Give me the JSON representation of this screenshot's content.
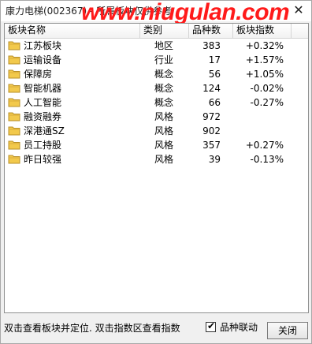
{
  "window": {
    "title": "康力电梯(002367) - 所属板块仅供参考",
    "watermark": "www.niugulan.com"
  },
  "table": {
    "headers": [
      "板块名称",
      "类别",
      "品种数",
      "板块指数"
    ],
    "rows": [
      {
        "name": "江苏板块",
        "category": "地区",
        "count": "383",
        "index": "+0.32%"
      },
      {
        "name": "运输设备",
        "category": "行业",
        "count": "17",
        "index": "+1.57%"
      },
      {
        "name": "保障房",
        "category": "概念",
        "count": "56",
        "index": "+1.05%"
      },
      {
        "name": "智能机器",
        "category": "概念",
        "count": "124",
        "index": "-0.02%"
      },
      {
        "name": "人工智能",
        "category": "概念",
        "count": "66",
        "index": "-0.27%"
      },
      {
        "name": "融资融券",
        "category": "风格",
        "count": "972",
        "index": ""
      },
      {
        "name": "深港通SZ",
        "category": "风格",
        "count": "902",
        "index": ""
      },
      {
        "name": "员工持股",
        "category": "风格",
        "count": "357",
        "index": "+0.27%"
      },
      {
        "name": "昨日较强",
        "category": "风格",
        "count": "39",
        "index": "-0.13%"
      }
    ]
  },
  "footer": {
    "hint": "双击查看板块并定位. 双击指数区查看指数",
    "checkbox_label": "品种联动",
    "checkbox_checked": "✔",
    "close_label": "关闭"
  },
  "colors": {
    "folder": "#f2c94c",
    "watermark": "#ff1a1a"
  },
  "icons": {
    "close": "close-icon",
    "folder": "folder-icon",
    "check": "checkmark-icon"
  }
}
